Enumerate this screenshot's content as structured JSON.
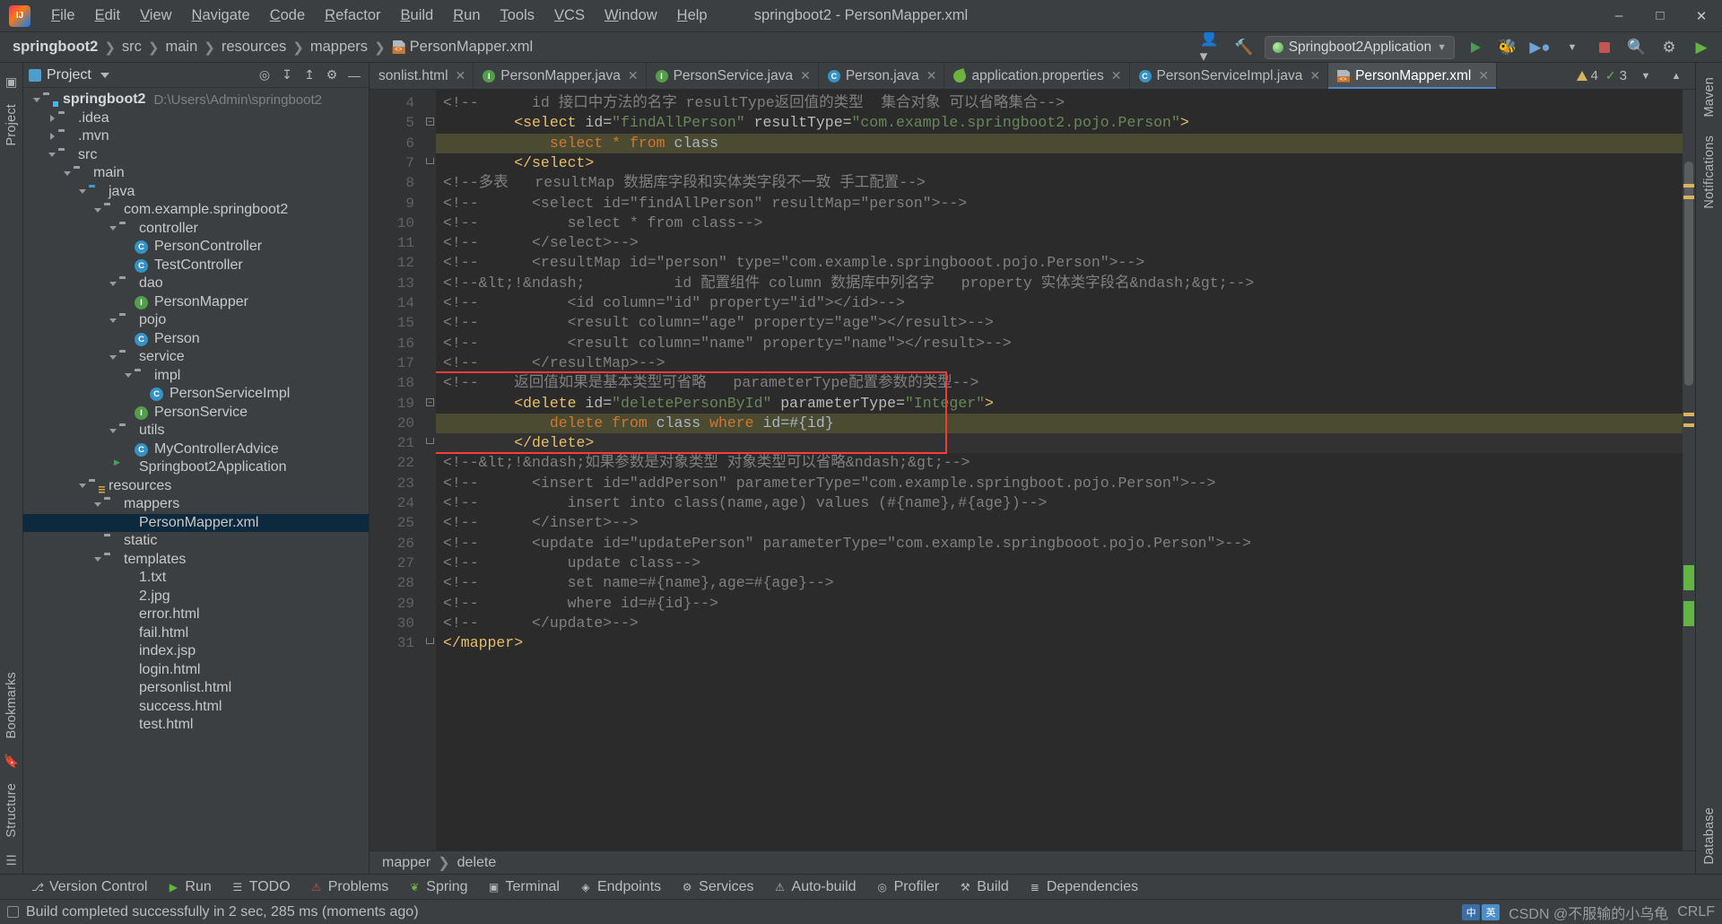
{
  "window": {
    "title": "springboot2 - PersonMapper.xml",
    "logo_icon": "intellij-idea-logo",
    "minimize_icon": "minimize-icon",
    "maximize_icon": "maximize-icon",
    "close_icon": "close-icon"
  },
  "menu": [
    "File",
    "Edit",
    "View",
    "Navigate",
    "Code",
    "Refactor",
    "Build",
    "Run",
    "Tools",
    "VCS",
    "Window",
    "Help"
  ],
  "navbar": {
    "crumbs": [
      "springboot2",
      "src",
      "main",
      "resources",
      "mappers",
      "PersonMapper.xml"
    ],
    "run_config": "Springboot2Application",
    "icons": [
      "user-settings-icon",
      "hammer-build-icon",
      "run-icon",
      "debug-icon",
      "run-with-coverage-icon",
      "profiler-icon",
      "stop-icon",
      "search-icon",
      "settings-gear-icon",
      "updates-icon"
    ]
  },
  "project_panel": {
    "title": "Project",
    "tools": [
      "collapse-all-icon",
      "expand-all-icon",
      "select-opened-file-icon",
      "settings-gear-icon",
      "hide-icon"
    ],
    "tree": [
      {
        "depth": 0,
        "arrow": "down",
        "icon": "module-folder",
        "label": "springboot2",
        "bold": true,
        "path": "D:\\Users\\Admin\\springboot2"
      },
      {
        "depth": 1,
        "arrow": "right",
        "icon": "folder",
        "label": ".idea"
      },
      {
        "depth": 1,
        "arrow": "right",
        "icon": "folder",
        "label": ".mvn"
      },
      {
        "depth": 1,
        "arrow": "down",
        "icon": "folder",
        "label": "src"
      },
      {
        "depth": 2,
        "arrow": "down",
        "icon": "folder",
        "label": "main"
      },
      {
        "depth": 3,
        "arrow": "down",
        "icon": "folder-blue",
        "label": "java"
      },
      {
        "depth": 4,
        "arrow": "down",
        "icon": "package",
        "label": "com.example.springboot2"
      },
      {
        "depth": 5,
        "arrow": "down",
        "icon": "package",
        "label": "controller"
      },
      {
        "depth": 6,
        "arrow": "none",
        "icon": "class",
        "label": "PersonController"
      },
      {
        "depth": 6,
        "arrow": "none",
        "icon": "class",
        "label": "TestController"
      },
      {
        "depth": 5,
        "arrow": "down",
        "icon": "package",
        "label": "dao"
      },
      {
        "depth": 6,
        "arrow": "none",
        "icon": "interface",
        "label": "PersonMapper"
      },
      {
        "depth": 5,
        "arrow": "down",
        "icon": "package",
        "label": "pojo"
      },
      {
        "depth": 6,
        "arrow": "none",
        "icon": "class",
        "label": "Person"
      },
      {
        "depth": 5,
        "arrow": "down",
        "icon": "package",
        "label": "service"
      },
      {
        "depth": 6,
        "arrow": "down",
        "icon": "package",
        "label": "impl"
      },
      {
        "depth": 7,
        "arrow": "none",
        "icon": "class",
        "label": "PersonServiceImpl"
      },
      {
        "depth": 6,
        "arrow": "none",
        "icon": "interface",
        "label": "PersonService"
      },
      {
        "depth": 5,
        "arrow": "down",
        "icon": "package",
        "label": "utils"
      },
      {
        "depth": 6,
        "arrow": "none",
        "icon": "class",
        "label": "MyControllerAdvice"
      },
      {
        "depth": 5,
        "arrow": "none",
        "icon": "spring-boot",
        "label": "Springboot2Application"
      },
      {
        "depth": 3,
        "arrow": "down",
        "icon": "resources-folder",
        "label": "resources"
      },
      {
        "depth": 4,
        "arrow": "down",
        "icon": "folder",
        "label": "mappers"
      },
      {
        "depth": 5,
        "arrow": "none",
        "icon": "xml-file",
        "label": "PersonMapper.xml",
        "selected": true
      },
      {
        "depth": 4,
        "arrow": "none",
        "icon": "folder",
        "label": "static"
      },
      {
        "depth": 4,
        "arrow": "down",
        "icon": "folder",
        "label": "templates"
      },
      {
        "depth": 5,
        "arrow": "none",
        "icon": "txt-file",
        "label": "1.txt"
      },
      {
        "depth": 5,
        "arrow": "none",
        "icon": "image-file",
        "label": "2.jpg"
      },
      {
        "depth": 5,
        "arrow": "none",
        "icon": "html-file",
        "label": "error.html"
      },
      {
        "depth": 5,
        "arrow": "none",
        "icon": "html-file",
        "label": "fail.html"
      },
      {
        "depth": 5,
        "arrow": "none",
        "icon": "jsp-file",
        "label": "index.jsp"
      },
      {
        "depth": 5,
        "arrow": "none",
        "icon": "html-file",
        "label": "login.html"
      },
      {
        "depth": 5,
        "arrow": "none",
        "icon": "html-file",
        "label": "personlist.html"
      },
      {
        "depth": 5,
        "arrow": "none",
        "icon": "html-file",
        "label": "success.html"
      },
      {
        "depth": 5,
        "arrow": "none",
        "icon": "html-file",
        "label": "test.html"
      }
    ]
  },
  "left_rail": [
    "Project",
    "Bookmarks",
    "Structure"
  ],
  "right_rail": [
    "Maven",
    "Notifications",
    "Database"
  ],
  "editor": {
    "tabs": [
      {
        "label": "sonlist.html",
        "icon": "html-file",
        "active": false,
        "truncated": true
      },
      {
        "label": "PersonMapper.java",
        "icon": "interface",
        "active": false
      },
      {
        "label": "PersonService.java",
        "icon": "interface",
        "active": false
      },
      {
        "label": "Person.java",
        "icon": "class",
        "active": false
      },
      {
        "label": "application.properties",
        "icon": "spring-leaf",
        "active": false
      },
      {
        "label": "PersonServiceImpl.java",
        "icon": "class",
        "active": false
      },
      {
        "label": "PersonMapper.xml",
        "icon": "xml-file",
        "active": true
      }
    ],
    "inspection": {
      "warnings": "4",
      "weak_warnings": "3",
      "warning_icon": "warning-triangle-icon",
      "ok_icon": "checkmark-icon"
    },
    "first_line_number": 4,
    "lines": [
      {
        "n": 4,
        "segs": [
          {
            "t": "<!--      id 接口中方法的名字 resultType返回值的类型  集合对象 可以省略集合-->",
            "c": "cmt"
          }
        ]
      },
      {
        "n": 5,
        "segs": [
          {
            "t": "        ",
            "c": "plain"
          },
          {
            "t": "<select",
            "c": "tagn"
          },
          {
            "t": " id=",
            "c": "attr"
          },
          {
            "t": "\"findAllPerson\"",
            "c": "str"
          },
          {
            "t": " resultType=",
            "c": "attr"
          },
          {
            "t": "\"com.example.springboot2.pojo.Person\"",
            "c": "str"
          },
          {
            "t": ">",
            "c": "tagn"
          }
        ],
        "fold": "start"
      },
      {
        "n": 6,
        "segs": [
          {
            "t": "            ",
            "c": "plain"
          },
          {
            "t": "select",
            "c": "kw"
          },
          {
            "t": " ",
            "c": "plain"
          },
          {
            "t": "*",
            "c": "kw"
          },
          {
            "t": " ",
            "c": "plain"
          },
          {
            "t": "from",
            "c": "kw"
          },
          {
            "t": " class",
            "c": "txt"
          }
        ],
        "hl": "sql"
      },
      {
        "n": 7,
        "segs": [
          {
            "t": "        ",
            "c": "plain"
          },
          {
            "t": "</select>",
            "c": "tagn"
          }
        ],
        "fold": "end"
      },
      {
        "n": 8,
        "segs": [
          {
            "t": "<!--多表   resultMap 数据库字段和实体类字段不一致 手工配置-->",
            "c": "cmt"
          }
        ]
      },
      {
        "n": 9,
        "segs": [
          {
            "t": "<!--      <select id=\"findAllPerson\" resultMap=\"person\">-->",
            "c": "cmt"
          }
        ]
      },
      {
        "n": 10,
        "segs": [
          {
            "t": "<!--          select * from class-->",
            "c": "cmt"
          }
        ]
      },
      {
        "n": 11,
        "segs": [
          {
            "t": "<!--      </select>-->",
            "c": "cmt"
          }
        ]
      },
      {
        "n": 12,
        "segs": [
          {
            "t": "<!--      <resultMap id=\"person\" type=\"com.example.springbooot.pojo.Person\">-->",
            "c": "cmt"
          }
        ]
      },
      {
        "n": 13,
        "segs": [
          {
            "t": "<!--&lt;!&ndash;          id 配置组件 column 数据库中列名字   property 实体类字段名&ndash;&gt;-->",
            "c": "cmt"
          }
        ]
      },
      {
        "n": 14,
        "segs": [
          {
            "t": "<!--          <id column=\"id\" property=\"id\"></id>-->",
            "c": "cmt"
          }
        ]
      },
      {
        "n": 15,
        "segs": [
          {
            "t": "<!--          <result column=\"age\" property=\"age\"></result>-->",
            "c": "cmt"
          }
        ]
      },
      {
        "n": 16,
        "segs": [
          {
            "t": "<!--          <result column=\"name\" property=\"name\"></result>-->",
            "c": "cmt"
          }
        ]
      },
      {
        "n": 17,
        "segs": [
          {
            "t": "<!--      </resultMap>-->",
            "c": "cmt"
          }
        ]
      },
      {
        "n": 18,
        "segs": [
          {
            "t": "<!--    返回值如果是基本类型可省略   parameterType配置参数的类型-->",
            "c": "cmt"
          }
        ],
        "boxed": true
      },
      {
        "n": 19,
        "segs": [
          {
            "t": "        ",
            "c": "plain"
          },
          {
            "t": "<delete",
            "c": "tagn"
          },
          {
            "t": " id=",
            "c": "attr"
          },
          {
            "t": "\"deletePersonById\"",
            "c": "str"
          },
          {
            "t": " parameterType=",
            "c": "attr"
          },
          {
            "t": "\"Integer\"",
            "c": "str"
          },
          {
            "t": ">",
            "c": "tagn"
          }
        ],
        "boxed": true,
        "fold": "start"
      },
      {
        "n": 20,
        "segs": [
          {
            "t": "            ",
            "c": "plain"
          },
          {
            "t": "delete",
            "c": "kw"
          },
          {
            "t": " ",
            "c": "plain"
          },
          {
            "t": "from",
            "c": "kw"
          },
          {
            "t": " class ",
            "c": "txt"
          },
          {
            "t": "where",
            "c": "kw"
          },
          {
            "t": " id=#{id}",
            "c": "txt"
          }
        ],
        "boxed": true,
        "hl": "sql"
      },
      {
        "n": 21,
        "segs": [
          {
            "t": "        ",
            "c": "plain"
          },
          {
            "t": "</delete>",
            "c": "tagn"
          }
        ],
        "boxed": true,
        "bulb": true,
        "fold": "end",
        "hl": "caret"
      },
      {
        "n": 22,
        "segs": [
          {
            "t": "<!--&lt;!&ndash;如果参数是对象类型 对象类型可以省略&ndash;&gt;-->",
            "c": "cmt"
          }
        ]
      },
      {
        "n": 23,
        "segs": [
          {
            "t": "<!--      <insert id=\"addPerson\" parameterType=\"com.example.springboot.pojo.Person\">-->",
            "c": "cmt"
          }
        ]
      },
      {
        "n": 24,
        "segs": [
          {
            "t": "<!--          insert into class(name,age) values (#{name},#{age})-->",
            "c": "cmt"
          }
        ]
      },
      {
        "n": 25,
        "segs": [
          {
            "t": "<!--      </insert>-->",
            "c": "cmt"
          }
        ]
      },
      {
        "n": 26,
        "segs": [
          {
            "t": "<!--      <update id=\"updatePerson\" parameterType=\"com.example.springbooot.pojo.Person\">-->",
            "c": "cmt"
          }
        ]
      },
      {
        "n": 27,
        "segs": [
          {
            "t": "<!--          update class-->",
            "c": "cmt"
          }
        ]
      },
      {
        "n": 28,
        "segs": [
          {
            "t": "<!--          set name=#{name},age=#{age}-->",
            "c": "cmt"
          }
        ]
      },
      {
        "n": 29,
        "segs": [
          {
            "t": "<!--          where id=#{id}-->",
            "c": "cmt"
          }
        ]
      },
      {
        "n": 30,
        "segs": [
          {
            "t": "<!--      </update>-->",
            "c": "cmt"
          }
        ]
      },
      {
        "n": 31,
        "segs": [
          {
            "t": "</mapper>",
            "c": "tagn"
          }
        ],
        "fold": "end"
      }
    ],
    "bottom_breadcrumb": [
      "mapper",
      "delete"
    ]
  },
  "bottom_toolwindows": [
    {
      "label": "Version Control",
      "icon": "branch-icon"
    },
    {
      "label": "Run",
      "icon": "run-icon"
    },
    {
      "label": "TODO",
      "icon": "todo-list-icon"
    },
    {
      "label": "Problems",
      "icon": "problems-icon"
    },
    {
      "label": "Spring",
      "icon": "spring-leaf-icon"
    },
    {
      "label": "Terminal",
      "icon": "terminal-icon"
    },
    {
      "label": "Endpoints",
      "icon": "endpoints-icon"
    },
    {
      "label": "Services",
      "icon": "services-icon"
    },
    {
      "label": "Auto-build",
      "icon": "auto-build-icon"
    },
    {
      "label": "Profiler",
      "icon": "profiler-icon"
    },
    {
      "label": "Build",
      "icon": "hammer-icon"
    },
    {
      "label": "Dependencies",
      "icon": "dependencies-icon"
    }
  ],
  "statusbar": {
    "icon": "event-log-icon",
    "message": "Build completed successfully in 2 sec, 285 ms (moments ago)",
    "watermark": "CSDN @不服输的小乌龟",
    "ime": [
      "中",
      "英"
    ],
    "right_text": "CRLF"
  },
  "colors": {
    "accent": "#4a88c7",
    "selection": "#0d293e",
    "red_highlight": "#fd3b3b",
    "background": "#3c3f41",
    "editor_bg": "#2b2b2b",
    "comment": "#808080",
    "string": "#6a8759",
    "keyword": "#cc7832",
    "tag": "#e8bf6a"
  }
}
